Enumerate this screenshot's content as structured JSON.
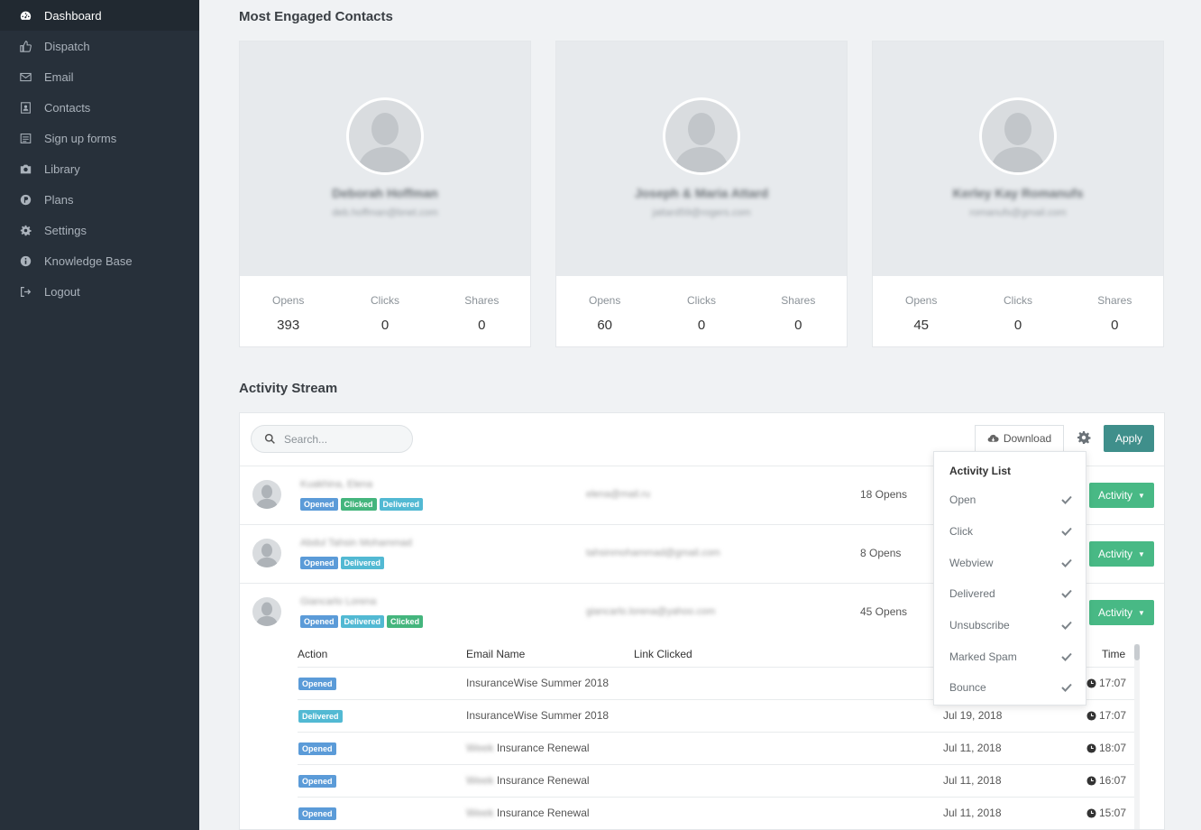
{
  "sidebar": {
    "items": [
      {
        "label": "Dashboard",
        "icon": "dashboard-icon"
      },
      {
        "label": "Dispatch",
        "icon": "thumbs-up-icon"
      },
      {
        "label": "Email",
        "icon": "envelope-icon"
      },
      {
        "label": "Contacts",
        "icon": "contact-card-icon"
      },
      {
        "label": "Sign up forms",
        "icon": "form-icon"
      },
      {
        "label": "Library",
        "icon": "camera-icon"
      },
      {
        "label": "Plans",
        "icon": "plans-icon"
      },
      {
        "label": "Settings",
        "icon": "gear-icon"
      },
      {
        "label": "Knowledge Base",
        "icon": "info-icon"
      },
      {
        "label": "Logout",
        "icon": "logout-icon"
      }
    ],
    "active": "Dashboard"
  },
  "engaged": {
    "title": "Most Engaged Contacts",
    "cards": [
      {
        "name": "Deborah Hoffman",
        "email": "deb.hoffman@bnet.com",
        "opens_label": "Opens",
        "opens": "393",
        "clicks_label": "Clicks",
        "clicks": "0",
        "shares_label": "Shares",
        "shares": "0"
      },
      {
        "name": "Joseph & Maria Attard",
        "email": "jattard59@rogers.com",
        "opens_label": "Opens",
        "opens": "60",
        "clicks_label": "Clicks",
        "clicks": "0",
        "shares_label": "Shares",
        "shares": "0"
      },
      {
        "name": "Kerley Kay Romanufs",
        "email": "romanufs@gmail.com",
        "opens_label": "Opens",
        "opens": "45",
        "clicks_label": "Clicks",
        "clicks": "0",
        "shares_label": "Shares",
        "shares": "0"
      }
    ]
  },
  "activity": {
    "title": "Activity Stream",
    "search_placeholder": "Search...",
    "download_label": "Download",
    "apply_label": "Apply",
    "rows": [
      {
        "name": "Kuakhina, Elena",
        "email": "elena@mail.ru",
        "opens": "18 Opens",
        "badges": [
          "Opened",
          "Clicked",
          "Delivered"
        ],
        "button": "Activity"
      },
      {
        "name": "Abdul Tahsin Mohammad",
        "email": "tahsinmohammad@gmail.com",
        "opens": "8 Opens",
        "badges": [
          "Opened",
          "Delivered"
        ],
        "button": "Activity"
      },
      {
        "name": "Giancarlo Lorena",
        "email": "giancarlo.lorena@yahoo.com",
        "opens": "45 Opens",
        "badges": [
          "Opened",
          "Delivered",
          "Clicked"
        ],
        "button": "Activity"
      }
    ],
    "detail": {
      "headers": {
        "action": "Action",
        "email_name": "Email Name",
        "link_clicked": "Link Clicked",
        "time": "Time"
      },
      "rows": [
        {
          "action": "Opened",
          "prefix": "",
          "email_name": "InsuranceWise Summer 2018",
          "date": "",
          "time": "17:07"
        },
        {
          "action": "Delivered",
          "prefix": "",
          "email_name": "InsuranceWise Summer 2018",
          "date": "Jul 19, 2018",
          "time": "17:07"
        },
        {
          "action": "Opened",
          "prefix": "Week",
          "email_name": "Insurance Renewal",
          "date": "Jul 11, 2018",
          "time": "18:07"
        },
        {
          "action": "Opened",
          "prefix": "Week",
          "email_name": "Insurance Renewal",
          "date": "Jul 11, 2018",
          "time": "16:07"
        },
        {
          "action": "Opened",
          "prefix": "Week",
          "email_name": "Insurance Renewal",
          "date": "Jul 11, 2018",
          "time": "15:07"
        }
      ]
    }
  },
  "dropdown": {
    "title": "Activity List",
    "items": [
      "Open",
      "Click",
      "Webview",
      "Delivered",
      "Unsubscribe",
      "Marked Spam",
      "Bounce"
    ]
  },
  "colors": {
    "sidebar_bg": "#27303a",
    "apply_btn": "#3f8f8b",
    "activity_btn": "#48b985",
    "badge_opened": "#5b9bd8",
    "badge_clicked": "#44b57d",
    "badge_delivered": "#52b9d3"
  }
}
